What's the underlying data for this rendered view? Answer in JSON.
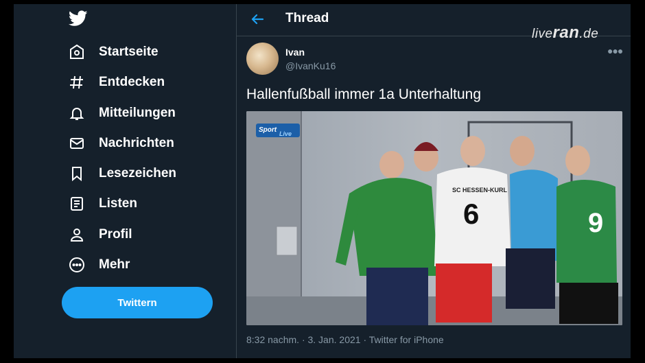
{
  "sidebar": {
    "items": [
      {
        "label": "Startseite",
        "icon": "home-icon"
      },
      {
        "label": "Entdecken",
        "icon": "hashtag-icon"
      },
      {
        "label": "Mitteilungen",
        "icon": "bell-icon"
      },
      {
        "label": "Nachrichten",
        "icon": "mail-icon"
      },
      {
        "label": "Lesezeichen",
        "icon": "bookmark-icon"
      },
      {
        "label": "Listen",
        "icon": "list-icon"
      },
      {
        "label": "Profil",
        "icon": "profile-icon"
      },
      {
        "label": "Mehr",
        "icon": "more-circle-icon"
      }
    ],
    "tweet_button": "Twittern"
  },
  "header": {
    "title": "Thread"
  },
  "watermark": {
    "part1": "live",
    "part2": "ran",
    "part3": ".de"
  },
  "tweet": {
    "name": "Ivan",
    "handle": "@IvanKu16",
    "text": "Hallenfußball immer 1a Unterhaltung",
    "meta": "8:32 nachm. · 3. Jan. 2021 · Twitter for iPhone",
    "media": {
      "logo_line1": "Sport",
      "logo_line2": "Live",
      "jersey_number_white": "6",
      "jersey_text_white": "SC HESSEN-KURL",
      "jersey_number_green": "9"
    }
  },
  "colors": {
    "bg": "#15202b",
    "accent": "#1da1f2",
    "muted": "#8899a6",
    "border": "#38444d"
  }
}
